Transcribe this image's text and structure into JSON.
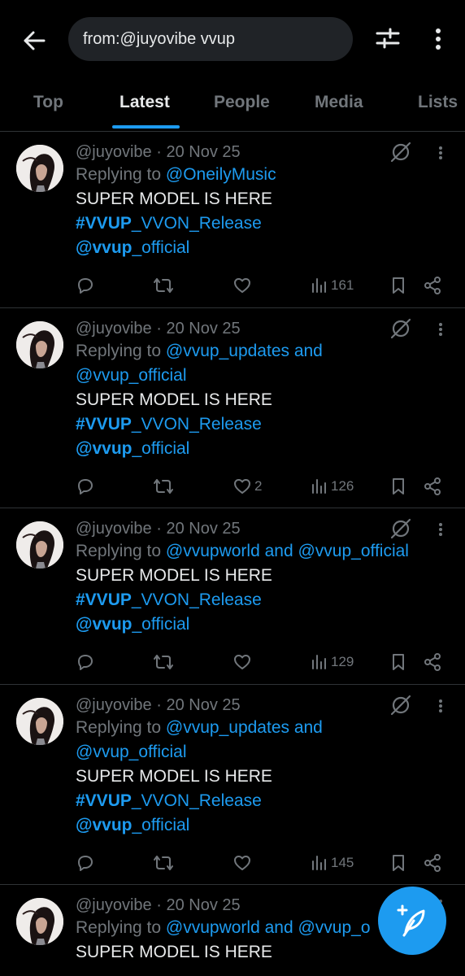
{
  "search": {
    "query": "from:@juyovibe vvup"
  },
  "tabs": [
    {
      "label": "Top"
    },
    {
      "label": "Latest"
    },
    {
      "label": "People"
    },
    {
      "label": "Media"
    },
    {
      "label": "Lists"
    }
  ],
  "tweets": [
    {
      "handle": "@juyovibe",
      "date": "20 Nov 25",
      "replying_prefix": "Replying to ",
      "replying_line1": "@OneilyMusic",
      "replying_line2": "",
      "text": "SUPER MODEL IS HERE",
      "hashtag_bold": "#VVUP",
      "hashtag_rest": "_VVON_Release",
      "mention_bold": "@vvup",
      "mention_rest": "_official",
      "likes": "",
      "views": "161"
    },
    {
      "handle": "@juyovibe",
      "date": "20 Nov 25",
      "replying_prefix": "Replying to ",
      "replying_line1": "@vvup_updates and",
      "replying_line2": "@vvup_official",
      "text": "SUPER MODEL IS HERE",
      "hashtag_bold": "#VVUP",
      "hashtag_rest": "_VVON_Release",
      "mention_bold": "@vvup",
      "mention_rest": "_official",
      "likes": "2",
      "views": "126"
    },
    {
      "handle": "@juyovibe",
      "date": "20 Nov 25",
      "replying_prefix": "Replying to ",
      "replying_line1": "@vvupworld and @vvup_official",
      "replying_line2": "",
      "text": "SUPER MODEL IS HERE",
      "hashtag_bold": "#VVUP",
      "hashtag_rest": "_VVON_Release",
      "mention_bold": "@vvup",
      "mention_rest": "_official",
      "likes": "",
      "views": "129"
    },
    {
      "handle": "@juyovibe",
      "date": "20 Nov 25",
      "replying_prefix": "Replying to ",
      "replying_line1": "@vvup_updates and",
      "replying_line2": "@vvup_official",
      "text": "SUPER MODEL IS HERE",
      "hashtag_bold": "#VVUP",
      "hashtag_rest": "_VVON_Release",
      "mention_bold": "@vvup",
      "mention_rest": "_official",
      "likes": "",
      "views": "145"
    },
    {
      "handle": "@juyovibe",
      "date": "20 Nov 25",
      "replying_prefix": "Replying to ",
      "replying_line1": "@vvupworld and @vvup_o",
      "replying_line2": "",
      "text": "SUPER MODEL IS HERE"
    }
  ],
  "icons": {
    "back": "back-arrow-icon",
    "filter": "sliders-icon",
    "more": "more-vertical-icon",
    "reply": "reply-icon",
    "retweet": "retweet-icon",
    "like": "heart-icon",
    "views": "views-icon",
    "bookmark": "bookmark-icon",
    "share": "share-icon",
    "grok": "grok-icon",
    "compose": "compose-icon"
  },
  "colors": {
    "accent": "#1d9bf0",
    "muted": "#71767b",
    "text": "#e7e9ea",
    "background": "#000000"
  }
}
